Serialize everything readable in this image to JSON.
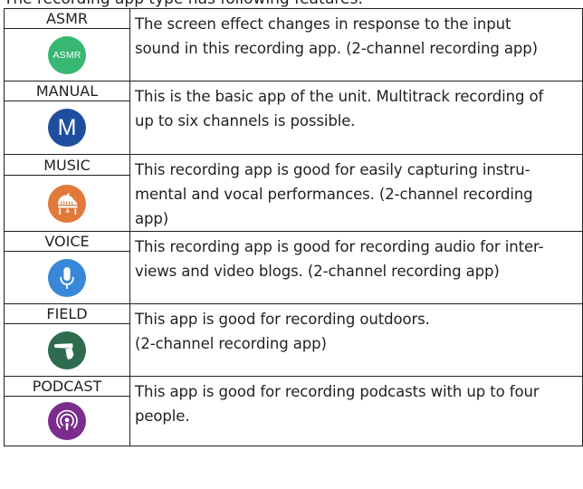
{
  "colors": {
    "asmr": "#37b772",
    "manual": "#1e4e9d",
    "music": "#e2793a",
    "voice": "#3987d9",
    "field": "#2f6b4f",
    "podcast": "#7a2d8c",
    "border": "#231f20",
    "text": "#231f20"
  },
  "apps": [
    {
      "name": "ASMR",
      "icon": "asmr-icon",
      "icon_text": "ASMR",
      "description_lines": [
        "The screen effect changes in response to the input",
        "sound in this recording app. (2-channel recording app)"
      ]
    },
    {
      "name": "MANUAL",
      "icon": "letter-m-icon",
      "icon_text": "M",
      "description_lines": [
        "This is the basic app of the unit. Multitrack recording of",
        "up to six channels is possible."
      ]
    },
    {
      "name": "MUSIC",
      "icon": "piano-icon",
      "description_lines": [
        "This recording app is good for easily capturing instru-",
        "mental and vocal performances. (2-channel recording",
        "app)"
      ]
    },
    {
      "name": "VOICE",
      "icon": "microphone-icon",
      "description_lines": [
        "This recording app is good for recording audio for inter-",
        "views and video blogs. (2-channel recording app)"
      ]
    },
    {
      "name": "FIELD",
      "icon": "shotgun-mic-icon",
      "description_lines": [
        "This app is good for recording outdoors.",
        "(2-channel recording app)"
      ]
    },
    {
      "name": "PODCAST",
      "icon": "podcast-icon",
      "description_lines": [
        "This app is good for recording podcasts with up to four",
        "people."
      ]
    }
  ]
}
